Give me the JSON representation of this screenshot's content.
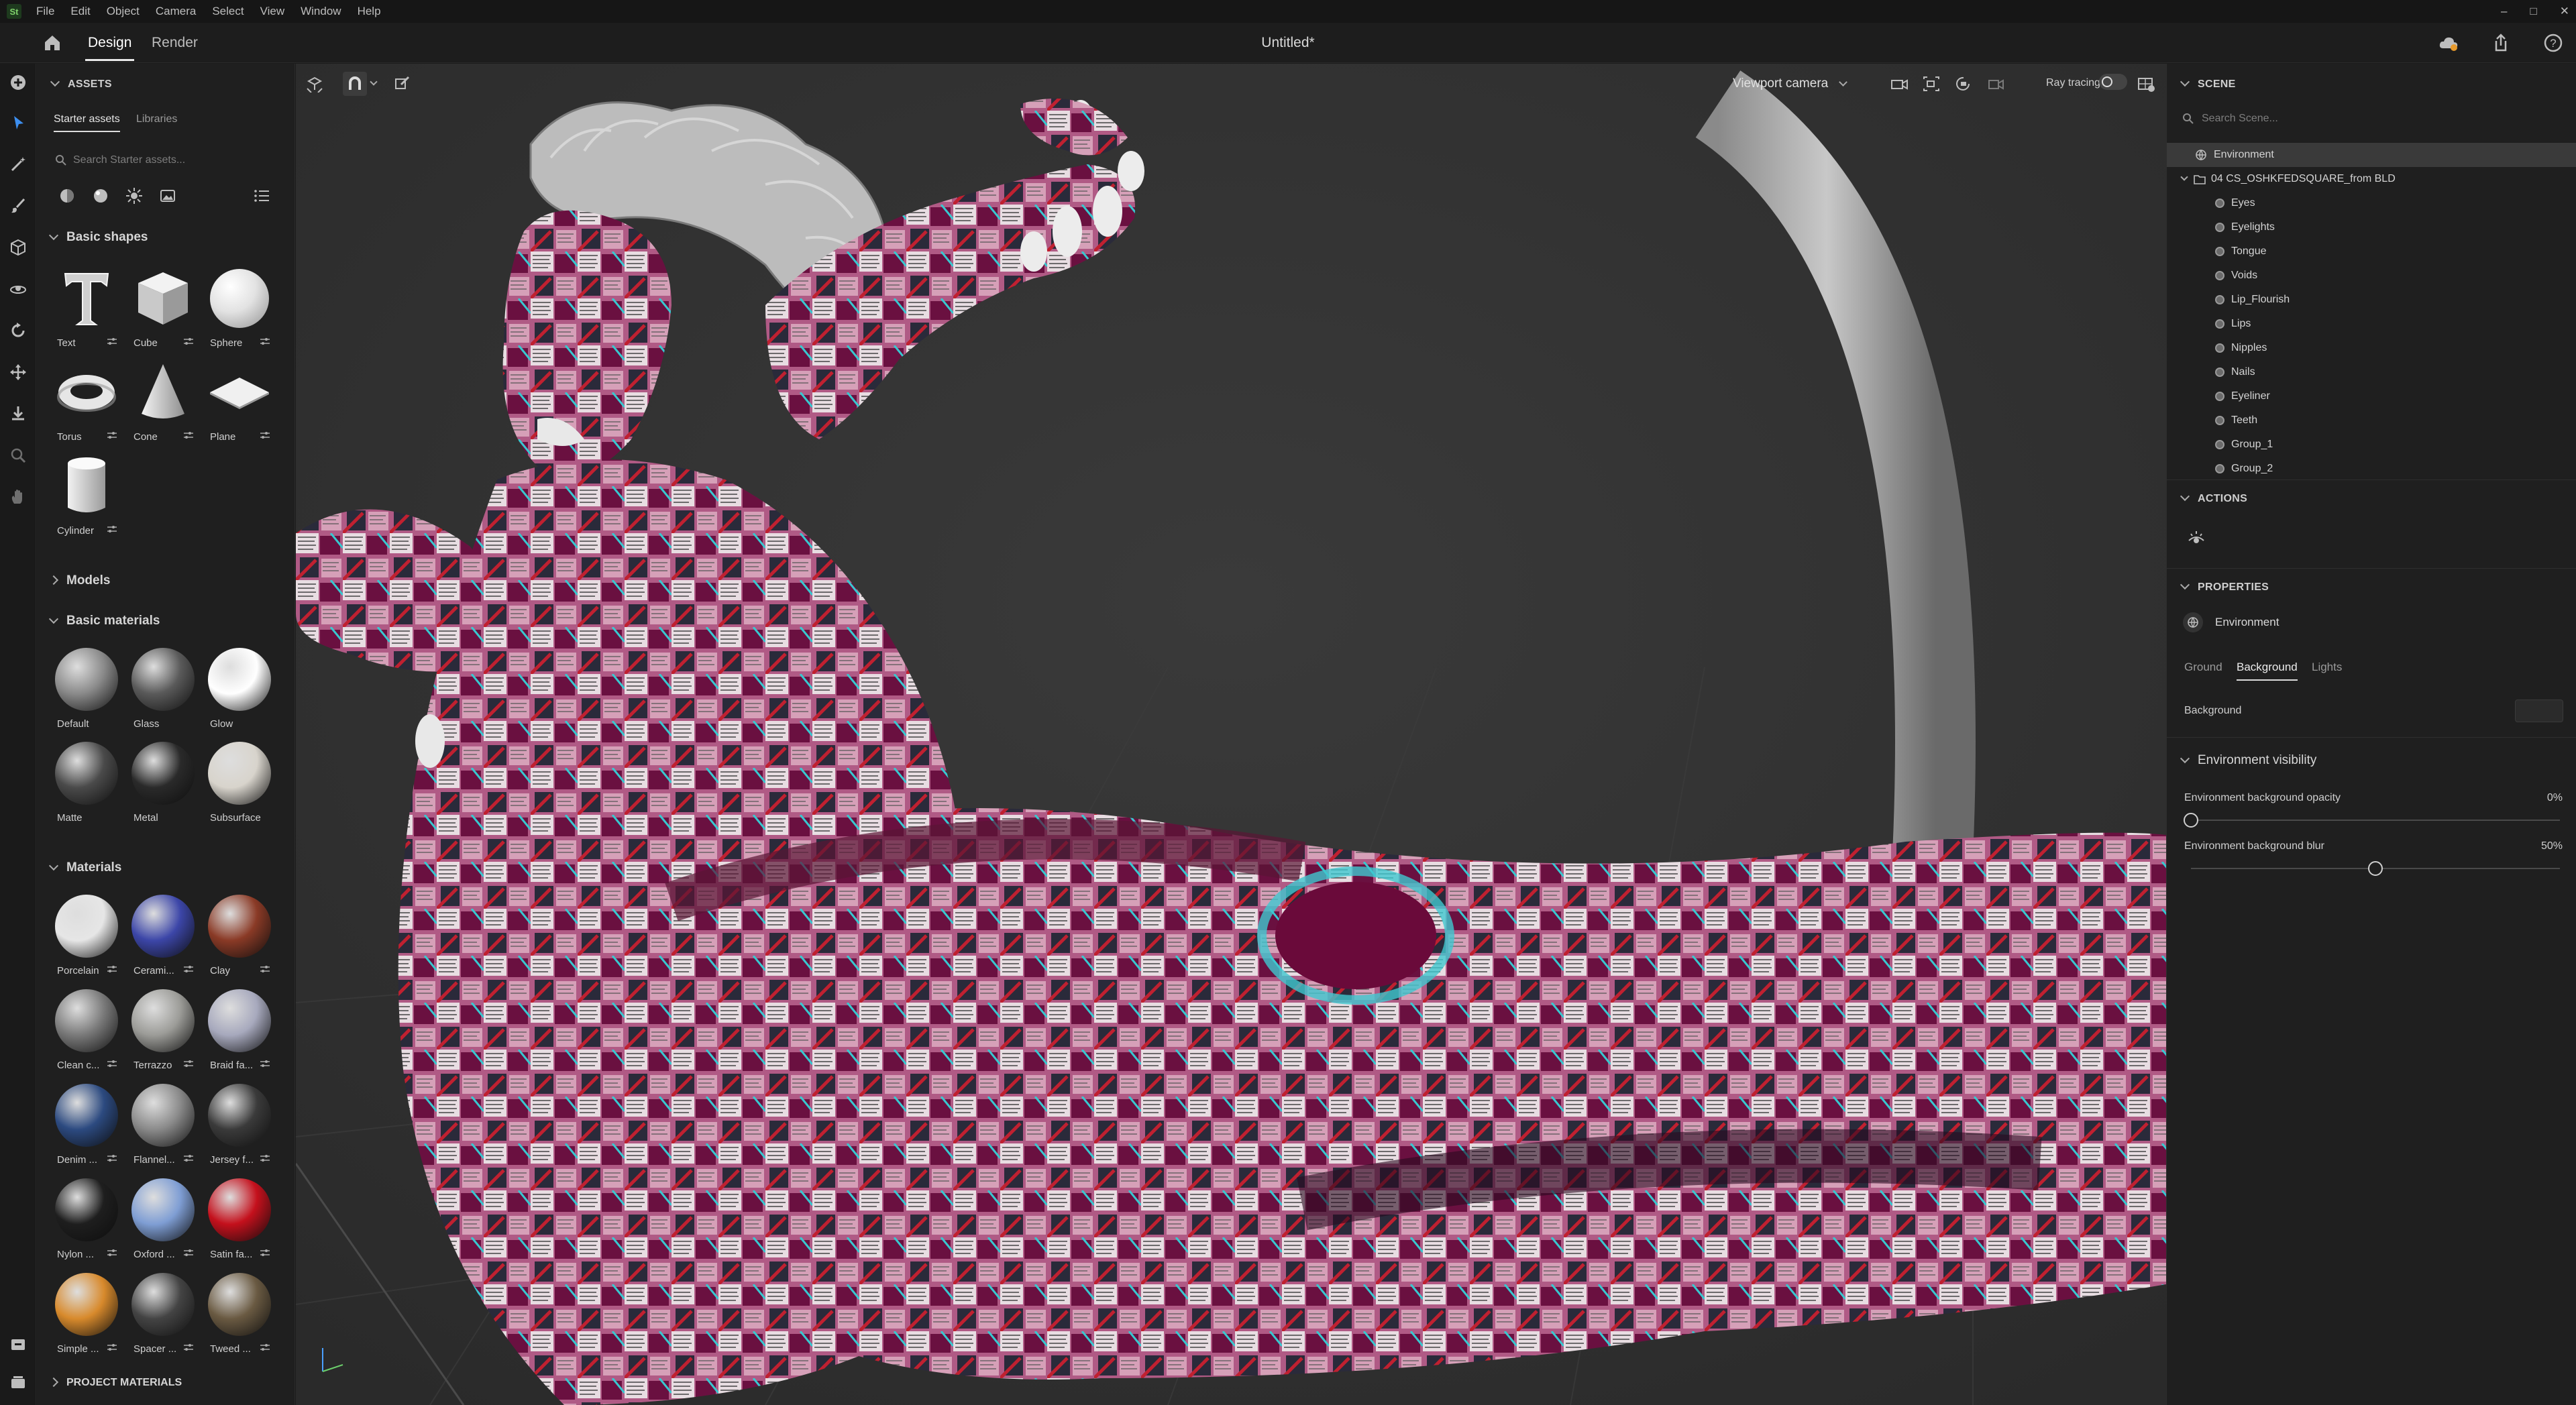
{
  "menubar": {
    "logo": "St",
    "items": [
      "File",
      "Edit",
      "Object",
      "Camera",
      "Select",
      "View",
      "Window",
      "Help"
    ],
    "window_controls": [
      "–",
      "□",
      "✕"
    ]
  },
  "tabbar": {
    "tabs": [
      {
        "label": "Design",
        "active": true
      },
      {
        "label": "Render",
        "active": false
      }
    ],
    "document_title": "Untitled*"
  },
  "assets": {
    "header": "ASSETS",
    "subtabs": [
      {
        "label": "Starter assets",
        "active": true
      },
      {
        "label": "Libraries",
        "active": false
      }
    ],
    "search_placeholder": "Search Starter assets...",
    "sections": {
      "basic_shapes": {
        "title": "Basic shapes",
        "items": [
          {
            "label": "Text",
            "icon": "text-shape"
          },
          {
            "label": "Cube",
            "icon": "cube-shape"
          },
          {
            "label": "Sphere",
            "icon": "sphere-shape"
          },
          {
            "label": "Torus",
            "icon": "torus-shape"
          },
          {
            "label": "Cone",
            "icon": "cone-shape"
          },
          {
            "label": "Plane",
            "icon": "plane-shape"
          },
          {
            "label": "Cylinder",
            "icon": "cylinder-shape"
          }
        ]
      },
      "models": {
        "title": "Models"
      },
      "basic_materials": {
        "title": "Basic materials",
        "items": [
          {
            "label": "Default",
            "color": "#8a8a8a"
          },
          {
            "label": "Glass",
            "color": "#5a5a5a"
          },
          {
            "label": "Glow",
            "color": "#ffffff"
          },
          {
            "label": "Matte",
            "color": "#4a4a4a"
          },
          {
            "label": "Metal",
            "color": "#2a2a2a"
          },
          {
            "label": "Subsurface",
            "color": "#d8d4cc"
          }
        ]
      },
      "materials": {
        "title": "Materials",
        "items": [
          {
            "label": "Porcelain",
            "color": "#e6e6e6"
          },
          {
            "label": "Cerami...",
            "color": "#3c46a8"
          },
          {
            "label": "Clay",
            "color": "#8a3a26"
          },
          {
            "label": "Clean c...",
            "color": "#7a7a7a"
          },
          {
            "label": "Terrazzo",
            "color": "#9c9c98"
          },
          {
            "label": "Braid fa...",
            "color": "#a7a9bd"
          },
          {
            "label": "Denim ...",
            "color": "#2c4a80"
          },
          {
            "label": "Flannel...",
            "color": "#8a8a8a"
          },
          {
            "label": "Jersey f...",
            "color": "#3a3a3a"
          },
          {
            "label": "Nylon ...",
            "color": "#1e1e1e"
          },
          {
            "label": "Oxford ...",
            "color": "#7f9ed4"
          },
          {
            "label": "Satin fa...",
            "color": "#c4101c"
          },
          {
            "label": "Simple ...",
            "color": "#d88a2c"
          },
          {
            "label": "Spacer ...",
            "color": "#444444"
          },
          {
            "label": "Tweed ...",
            "color": "#6a5a42"
          }
        ]
      },
      "project_materials": {
        "title": "PROJECT MATERIALS"
      }
    }
  },
  "viewport": {
    "camera": "Viewport camera",
    "ray_tracing_label": "Ray tracing",
    "ray_tracing_on": false
  },
  "scene": {
    "header": "SCENE",
    "search_placeholder": "Search Scene...",
    "environment": "Environment",
    "group": "04 CS_OSHKFEDSQUARE_from BLD",
    "children": [
      "Eyes",
      "Eyelights",
      "Tongue",
      "Voids",
      "Lip_Flourish",
      "Lips",
      "Nipples",
      "Nails",
      "Eyeliner",
      "Teeth",
      "Group_1",
      "Group_2"
    ]
  },
  "actions": {
    "header": "ACTIONS"
  },
  "properties": {
    "header": "PROPERTIES",
    "object": "Environment",
    "tabs": [
      {
        "label": "Ground",
        "active": false
      },
      {
        "label": "Background",
        "active": true
      },
      {
        "label": "Lights",
        "active": false
      }
    ],
    "background_label": "Background",
    "background_swatch": "#2b2b2b",
    "visibility_section": "Environment visibility",
    "opacity_label": "Environment background opacity",
    "opacity_value": "0%",
    "opacity": 0,
    "blur_label": "Environment background blur",
    "blur_value": "50%",
    "blur": 0.5
  }
}
